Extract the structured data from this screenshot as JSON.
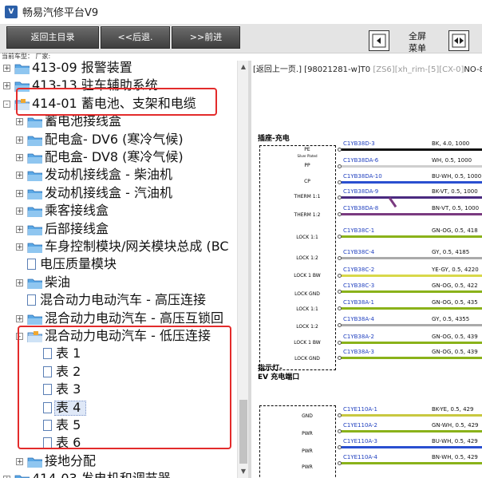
{
  "app": {
    "title": "畅易汽修平台V9",
    "icon_name": "app-logo-icon"
  },
  "toolbar": {
    "back_main": "返回主目录",
    "prev": "<<后退.",
    "next": ">>前进",
    "fullscreen_label": "全屏\n菜单",
    "icon_left": "collapse-panel-icon",
    "icon_right": "expand-panel-icon"
  },
  "model_bar": "当前车型： 厂家:",
  "tree": {
    "nodes": [
      {
        "label": "413-09 报警装置",
        "level": 0,
        "expander": "+",
        "icon": "folder-icon"
      },
      {
        "label": "413-13 驻车辅助系统",
        "level": 0,
        "expander": "+",
        "icon": "folder-icon"
      },
      {
        "label": "414-01 蓄电池、支架和电缆",
        "level": 0,
        "expander": "-",
        "icon": "folder-open-icon"
      },
      {
        "label": "蓄电池接线盒",
        "level": 1,
        "expander": "+",
        "icon": "folder-icon"
      },
      {
        "label": "配电盒- DV6 (寒冷气候)",
        "level": 1,
        "expander": "+",
        "icon": "folder-icon"
      },
      {
        "label": "配电盒- DV8 (寒冷气候)",
        "level": 1,
        "expander": "+",
        "icon": "folder-icon"
      },
      {
        "label": "发动机接线盒 - 柴油机",
        "level": 1,
        "expander": "+",
        "icon": "folder-icon"
      },
      {
        "label": "发动机接线盒 - 汽油机",
        "level": 1,
        "expander": "+",
        "icon": "folder-icon"
      },
      {
        "label": "乘客接线盒",
        "level": 1,
        "expander": "+",
        "icon": "folder-icon"
      },
      {
        "label": "后部接线盒",
        "level": 1,
        "expander": "+",
        "icon": "folder-icon"
      },
      {
        "label": "车身控制模块/网关模块总成 (BC",
        "level": 1,
        "expander": "+",
        "icon": "folder-icon"
      },
      {
        "label": "电压质量模块",
        "level": 1,
        "expander": "",
        "icon": "document-icon"
      },
      {
        "label": "柴油",
        "level": 1,
        "expander": "+",
        "icon": "folder-icon"
      },
      {
        "label": "混合动力电动汽车 - 高压连接",
        "level": 1,
        "expander": "",
        "icon": "document-icon"
      },
      {
        "label": "混合动力电动汽车 - 高压互锁回",
        "level": 1,
        "expander": "+",
        "icon": "folder-icon"
      },
      {
        "label": "混合动力电动汽车 - 低压连接",
        "level": 1,
        "expander": "-",
        "icon": "folder-open-icon"
      },
      {
        "label": "表 1",
        "level": 2,
        "expander": "",
        "icon": "document-icon"
      },
      {
        "label": "表 2",
        "level": 2,
        "expander": "",
        "icon": "document-icon"
      },
      {
        "label": "表 3",
        "level": 2,
        "expander": "",
        "icon": "document-icon"
      },
      {
        "label": "表 4",
        "level": 2,
        "expander": "",
        "icon": "document-icon",
        "selected": true
      },
      {
        "label": "表 5",
        "level": 2,
        "expander": "",
        "icon": "document-icon"
      },
      {
        "label": "表 6",
        "level": 2,
        "expander": "",
        "icon": "document-icon"
      },
      {
        "label": "接地分配",
        "level": 1,
        "expander": "+",
        "icon": "folder-icon"
      },
      {
        "label": "414-03 发电机和调节器",
        "level": 0,
        "expander": "+",
        "icon": "folder-icon"
      }
    ]
  },
  "content": {
    "header_back": "[返回上一页.]",
    "header_code": "[98021281-w]T0",
    "header_grey": "[ZS6][xh_rim-[5][CX-0]",
    "header_tail": "NO-8",
    "section1": {
      "title": "插座-充电",
      "pins": [
        "PE",
        "Silver Plated",
        "PP",
        "CP",
        "THERM 1:1",
        "THERM 1:2",
        "LOCK 1:1",
        "LOCK 1:2",
        "LOCK 1 BW",
        "LOCK GND",
        "LOCK 1:1",
        "LOCK 1:2",
        "LOCK 1 BW",
        "LOCK GND"
      ],
      "wires": [
        {
          "id": "C1YB38D-3",
          "spec": "BK, 4.0, 1000",
          "color": "#111111"
        },
        {
          "id": "C1YB38DA-6",
          "spec": "WH, 0.5, 1000",
          "color": "#cfcfcf"
        },
        {
          "id": "C1YB38DA-10",
          "spec": "BU-WH, 0.5, 1000",
          "color": "#2a4fd0"
        },
        {
          "id": "C1YB38DA-9",
          "spec": "BK-VT, 0.5, 1000",
          "color": "#4a2a80"
        },
        {
          "id": "C1YB38DA-8",
          "spec": "BN-VT, 0.5, 1000",
          "color": "#7a3a80"
        },
        {
          "id": "C1YB38C-1",
          "spec": "GN-OG, 0.5, 418",
          "color": "#8ab21a"
        },
        {
          "id": "C1YB38C-4",
          "spec": "GY, 0.5, 4185",
          "color": "#aaaaaa"
        },
        {
          "id": "C1YB38C-2",
          "spec": "YE-GY, 0.5, 4220",
          "color": "#d8d84a"
        },
        {
          "id": "C1YB38C-3",
          "spec": "GN-OG, 0.5, 422",
          "color": "#8ab21a"
        },
        {
          "id": "C1YB38A-1",
          "spec": "GN-OG, 0.5, 435",
          "color": "#8ab21a"
        },
        {
          "id": "C1YB38A-4",
          "spec": "GY, 0.5, 4355",
          "color": "#aaaaaa"
        },
        {
          "id": "C1YB38A-2",
          "spec": "GN-OG, 0.5, 439",
          "color": "#8ab21a"
        },
        {
          "id": "C1YB38A-3",
          "spec": "GN-OG, 0.5, 439",
          "color": "#8ab21a"
        }
      ]
    },
    "section2": {
      "title_line1": "指示灯-",
      "title_line2": "EV 充电端口",
      "pins": [
        "GND",
        "PWR",
        "PWR",
        "PWR"
      ],
      "wires": [
        {
          "id": "C1YE110A-1",
          "spec": "BK-YE, 0.5, 429",
          "color": "#c8c840"
        },
        {
          "id": "C1YE110A-2",
          "spec": "GN-WH, 0.5, 429",
          "color": "#8ab21a"
        },
        {
          "id": "C1YE110A-3",
          "spec": "BU-WH, 0.5, 429",
          "color": "#2a4fd0"
        },
        {
          "id": "C1YE110A-4",
          "spec": "BN-WH, 0.5, 429",
          "color": "#8ab21a"
        }
      ]
    }
  },
  "colors": {
    "highlight": "#e32b2b",
    "link": "#1f3fbf",
    "toolbar_button": "#4a4a4a"
  }
}
